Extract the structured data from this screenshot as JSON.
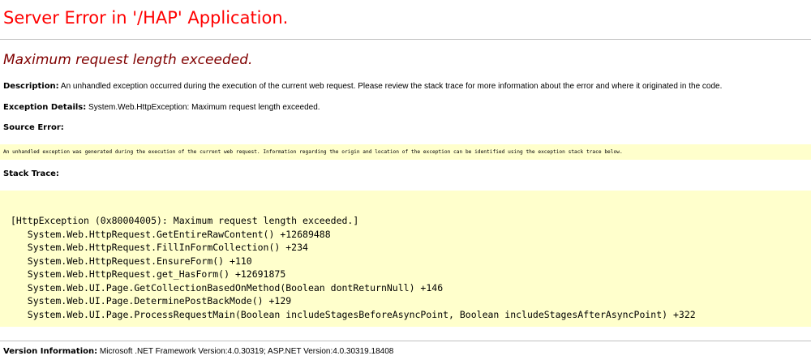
{
  "header": {
    "title": "Server Error in '/HAP' Application."
  },
  "error": {
    "message": "Maximum request length exceeded.",
    "description_label": "Description:",
    "description_text": " An unhandled exception occurred during the execution of the current web request. Please review the stack trace for more information about the error and where it originated in the code.",
    "exception_label": "Exception Details:",
    "exception_text": " System.Web.HttpException: Maximum request length exceeded.",
    "source_label": "Source Error:",
    "source_text": "An unhandled exception was generated during the execution of the current web request. Information regarding the origin and location of the exception can be identified using the exception stack trace below.",
    "stack_label": "Stack Trace:",
    "stack_lines": [
      "[HttpException (0x80004005): Maximum request length exceeded.]",
      "   System.Web.HttpRequest.GetEntireRawContent() +12689488",
      "   System.Web.HttpRequest.FillInFormCollection() +234",
      "   System.Web.HttpRequest.EnsureForm() +110",
      "   System.Web.HttpRequest.get_HasForm() +12691875",
      "   System.Web.UI.Page.GetCollectionBasedOnMethod(Boolean dontReturnNull) +146",
      "   System.Web.UI.Page.DeterminePostBackMode() +129",
      "   System.Web.UI.Page.ProcessRequestMain(Boolean includeStagesBeforeAsyncPoint, Boolean includeStagesAfterAsyncPoint) +322"
    ]
  },
  "footer": {
    "version_label": "Version Information:",
    "version_text": " Microsoft .NET Framework Version:4.0.30319; ASP.NET Version:4.0.30319.18408"
  },
  "colors": {
    "title": "#ff0000",
    "message": "#800000",
    "code_background": "#ffffcc",
    "rule": "#c0c0c0"
  }
}
